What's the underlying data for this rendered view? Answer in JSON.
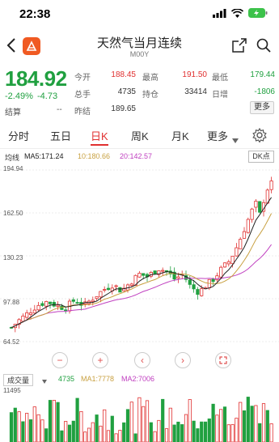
{
  "status": {
    "time": "22:38",
    "signal_icon": "signal-bars-icon",
    "wifi_icon": "wifi-icon",
    "battery_icon": "battery-charging-icon"
  },
  "header": {
    "title": "天然气当月连续",
    "code": "M00Y",
    "back_icon": "chevron-left-icon",
    "share_icon": "share-icon",
    "search_icon": "search-icon"
  },
  "quote": {
    "price": "184.92",
    "change_pct": "-2.49%",
    "change": "-4.73",
    "settle_label": "结算",
    "settle_value": "--",
    "open_label": "今开",
    "open": "188.45",
    "high_label": "最高",
    "high": "191.50",
    "low_label": "最低",
    "low": "179.44",
    "volume_label": "总手",
    "volume": "4735",
    "oi_label": "持仓",
    "oi": "33414",
    "daily_inc_label": "日增",
    "daily_inc": "-1806",
    "prev_settle_label": "昨结",
    "prev_settle": "189.65",
    "more_label": "更多"
  },
  "tabs": [
    "分时",
    "五日",
    "日K",
    "周K",
    "月K",
    "更多"
  ],
  "active_tab": "日K",
  "ma": {
    "label": "均线",
    "ma5": "MA5:171.24",
    "ma10": "10:180.66",
    "ma20": "20:142.57",
    "dk_label": "DK点"
  },
  "colors": {
    "up": "#e03030",
    "down": "#20a040",
    "ma5": "#222222",
    "ma10": "#c8a040",
    "ma20": "#c040c0"
  },
  "chart_data": {
    "type": "candlestick",
    "y_ticks": [
      "194.94",
      "162.50",
      "130.23",
      "97.88",
      "64.52"
    ],
    "ylim": [
      64.52,
      194.94
    ]
  },
  "controls": {
    "minus": "−",
    "plus": "+",
    "left": "‹",
    "right": "›"
  },
  "volume": {
    "selector": "成交量",
    "value": "4735",
    "ma1": "MA1:7778",
    "ma2": "MA2:7006",
    "top_tick": "11495"
  }
}
